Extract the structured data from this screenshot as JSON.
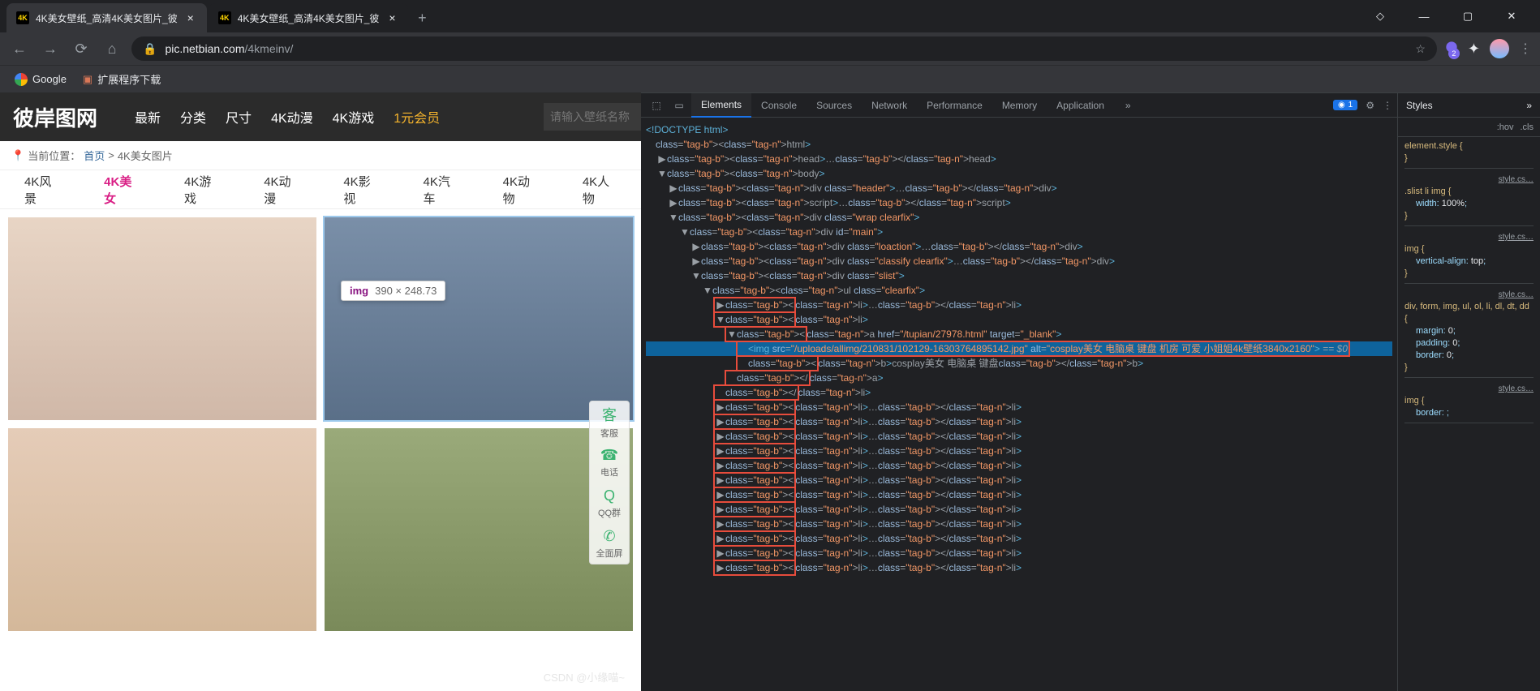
{
  "browser": {
    "tabs": [
      {
        "favicon": "4K",
        "title": "4K美女壁纸_高清4K美女图片_彼"
      },
      {
        "favicon": "4K",
        "title": "4K美女壁纸_高清4K美女图片_彼"
      }
    ],
    "url_display_domain": "pic.netbian.com",
    "url_display_path": "/4kmeinv/",
    "bookmarks": [
      {
        "icon": "google",
        "label": "Google"
      },
      {
        "icon": "ext",
        "label": "扩展程序下载"
      }
    ],
    "ext_badge": "2"
  },
  "site": {
    "logo": "彼岸图网",
    "nav": [
      "最新",
      "分类",
      "尺寸",
      "4K动漫",
      "4K游戏",
      "1元会员"
    ],
    "nav_active_index": 5,
    "search_placeholder": "请输入壁纸名称",
    "breadcrumb_label": "当前位置：",
    "breadcrumb_home": "首页",
    "breadcrumb_sep": ">",
    "breadcrumb_current": "4K美女图片",
    "categories": [
      "4K风景",
      "4K美女",
      "4K游戏",
      "4K动漫",
      "4K影视",
      "4K汽车",
      "4K动物",
      "4K人物"
    ],
    "categories_active_index": 1,
    "inspect_tooltip": {
      "tag": "img",
      "dims": "390 × 248.73"
    },
    "side_widget": [
      {
        "icon": "客",
        "label": "客服"
      },
      {
        "icon": "☎",
        "label": "电话"
      },
      {
        "icon": "Q",
        "label": "QQ群"
      },
      {
        "icon": "✆",
        "label": "全面屏"
      }
    ]
  },
  "devtools": {
    "tabs": [
      "Elements",
      "Console",
      "Sources",
      "Network",
      "Performance",
      "Memory",
      "Application"
    ],
    "active_tab_index": 0,
    "error_count": "1",
    "styles_header": "Styles",
    "hov": ":hov",
    "cls": ".cls",
    "rules": [
      {
        "src": "",
        "sel": "element.style {",
        "props": [],
        "close": "}"
      },
      {
        "src": "style.cs…",
        "sel": ".slist li img {",
        "props": [
          {
            "p": "width",
            "v": "100%"
          }
        ],
        "close": "}"
      },
      {
        "src": "style.cs…",
        "sel": "img {",
        "props": [
          {
            "p": "vertical-align",
            "v": "top"
          }
        ],
        "close": "}"
      },
      {
        "src": "style.cs…",
        "sel": "div, form, img, ul, ol, li, dl, dt, dd {",
        "props": [
          {
            "p": "margin",
            "v": "0"
          },
          {
            "p": "padding",
            "v": "0"
          },
          {
            "p": "border",
            "v": "0"
          }
        ],
        "close": "}"
      },
      {
        "src": "style.cs…",
        "sel": "img {",
        "props": [
          {
            "p": "border",
            "v": ""
          }
        ],
        "close": ""
      }
    ],
    "dom": {
      "doctype": "<!DOCTYPE html>",
      "lines": [
        {
          "ind": 0,
          "html": "<html>"
        },
        {
          "ind": 1,
          "collapsed": true,
          "html": "<head>…</head>"
        },
        {
          "ind": 1,
          "open": true,
          "html": "<body>"
        },
        {
          "ind": 2,
          "collapsed": true,
          "html": "<div class=\"header\">…</div>"
        },
        {
          "ind": 2,
          "collapsed": true,
          "html": "<script>…</script>"
        },
        {
          "ind": 2,
          "open": true,
          "html": "<div class=\"wrap clearfix\">"
        },
        {
          "ind": 3,
          "open": true,
          "html": "<div id=\"main\">"
        },
        {
          "ind": 4,
          "collapsed": true,
          "html": "<div class=\"loaction\">…</div>"
        },
        {
          "ind": 4,
          "collapsed": true,
          "html": "<div class=\"classify clearfix\">…</div>"
        },
        {
          "ind": 4,
          "open": true,
          "html": "<div class=\"slist\">"
        },
        {
          "ind": 5,
          "open": true,
          "html": "<ul class=\"clearfix\">"
        },
        {
          "ind": 6,
          "collapsed": true,
          "boxed": true,
          "html": "<li>…</li>"
        },
        {
          "ind": 6,
          "open": true,
          "boxed": true,
          "html": "<li>"
        },
        {
          "ind": 7,
          "open": true,
          "boxed": true,
          "html": "<a href=\"/tupian/27978.html\" target=\"_blank\">"
        },
        {
          "ind": 8,
          "hl": true,
          "boxed": true,
          "html_img": true
        },
        {
          "ind": 8,
          "boxed": true,
          "text": "<b>cosplay美女 电脑桌 键盘</b>"
        },
        {
          "ind": 7,
          "boxed": true,
          "html": "</a>"
        },
        {
          "ind": 6,
          "boxed": true,
          "html": "</li>"
        },
        {
          "ind": 6,
          "collapsed": true,
          "boxed": true,
          "html": "<li>…</li>"
        },
        {
          "ind": 6,
          "collapsed": true,
          "boxed": true,
          "html": "<li>…</li>"
        },
        {
          "ind": 6,
          "collapsed": true,
          "boxed": true,
          "html": "<li>…</li>"
        },
        {
          "ind": 6,
          "collapsed": true,
          "boxed": true,
          "html": "<li>…</li>"
        },
        {
          "ind": 6,
          "collapsed": true,
          "boxed": true,
          "html": "<li>…</li>"
        },
        {
          "ind": 6,
          "collapsed": true,
          "boxed": true,
          "html": "<li>…</li>"
        },
        {
          "ind": 6,
          "collapsed": true,
          "boxed": true,
          "html": "<li>…</li>"
        },
        {
          "ind": 6,
          "collapsed": true,
          "boxed": true,
          "html": "<li>…</li>"
        },
        {
          "ind": 6,
          "collapsed": true,
          "boxed": true,
          "html": "<li>…</li>"
        },
        {
          "ind": 6,
          "collapsed": true,
          "boxed": true,
          "html": "<li>…</li>"
        },
        {
          "ind": 6,
          "collapsed": true,
          "boxed": true,
          "html": "<li>…</li>"
        },
        {
          "ind": 6,
          "collapsed": true,
          "boxed": true,
          "html": "<li>…</li>"
        }
      ],
      "img_src": "/uploads/allimg/210831/102129-16303764895142.jpg",
      "img_alt": "cosplay美女 电脑桌 键盘 机房 可爱 小姐姐4k壁纸3840x2160",
      "eq0": " == $0"
    }
  },
  "watermark": "CSDN @小缘喵~"
}
